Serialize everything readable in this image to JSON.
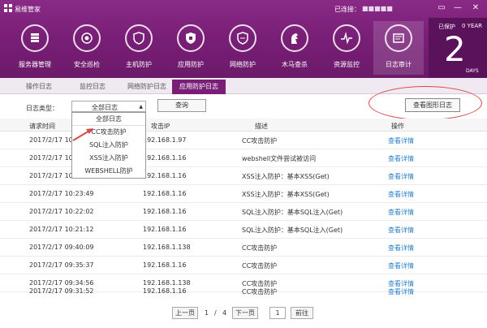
{
  "window": {
    "title": "易维管家",
    "connection_label": "已连接：",
    "connection_value": "■■■■■",
    "controls": [
      "▭",
      "—",
      "✕"
    ]
  },
  "nav": [
    {
      "label": "服务器管理",
      "icon": "server-cloud-icon"
    },
    {
      "label": "安全巡检",
      "icon": "target-icon"
    },
    {
      "label": "主机防护",
      "icon": "shield-icon"
    },
    {
      "label": "应用防护",
      "icon": "app-shield-icon"
    },
    {
      "label": "网络防护",
      "icon": "network-shield-icon"
    },
    {
      "label": "木马查杀",
      "icon": "horse-icon"
    },
    {
      "label": "资源监控",
      "icon": "pulse-icon"
    },
    {
      "label": "日志审计",
      "icon": "log-icon"
    }
  ],
  "protection": {
    "label": "已保护",
    "year": "0 YEAR",
    "days": "2",
    "days_label": "DAYS"
  },
  "tabs": [
    "操作日志",
    "监控日志",
    "网络防护日志",
    "应用防护日志"
  ],
  "filter": {
    "label": "日志类型：",
    "selected": "全部日志",
    "query_button": "查询",
    "graph_button": "查看图形日志"
  },
  "dropdown_options": [
    "全部日志",
    "CC攻击防护",
    "SQL注入防护",
    "XSS注入防护",
    "WEBSHELL防护"
  ],
  "table": {
    "headers": [
      "请求时间",
      "攻击IP",
      "描述",
      "操作"
    ],
    "rows": [
      {
        "time": "2017/2/17 10",
        "ip": "192.168.1.97",
        "desc": "CC攻击防护",
        "action": "查看详情"
      },
      {
        "time": "2017/2/17 10",
        "ip": "192.168.1.16",
        "desc": "webshell文件尝试被访问",
        "action": "查看详情"
      },
      {
        "time": "2017/2/17 10",
        "ip": "192.168.1.16",
        "desc": "XSS注入防护：基本XSS(Get)",
        "action": "查看详情"
      },
      {
        "time": "2017/2/17 10:23:49",
        "ip": "192.168.1.16",
        "desc": "XSS注入防护：基本XSS(Get)",
        "action": "查看详情"
      },
      {
        "time": "2017/2/17 10:22:02",
        "ip": "192.168.1.16",
        "desc": "SQL注入防护：基本SQL注入(Get)",
        "action": "查看详情"
      },
      {
        "time": "2017/2/17 10:21:12",
        "ip": "192.168.1.16",
        "desc": "SQL注入防护：基本SQL注入(Get)",
        "action": "查看详情"
      },
      {
        "time": "2017/2/17 09:40:09",
        "ip": "192.168.1.138",
        "desc": "CC攻击防护",
        "action": "查看详情"
      },
      {
        "time": "2017/2/17 09:35:37",
        "ip": "192.168.1.16",
        "desc": "CC攻击防护",
        "action": "查看详情"
      },
      {
        "time": "2017/2/17 09:34:56",
        "ip": "192.168.1.138",
        "desc": "CC攻击防护",
        "action": "查看详情"
      },
      {
        "time": "2017/2/17 09:31:52",
        "ip": "192.168.1.16",
        "desc": "CC攻击防护",
        "action": "查看详情"
      }
    ]
  },
  "pagination": {
    "prev": "上一页",
    "current": "1",
    "separator": "/",
    "total": "4",
    "next": "下一页",
    "goto_value": "1",
    "goto_button": "前往"
  },
  "colors": {
    "brand": "#7a1f78",
    "link": "#2a7fc7",
    "annotation": "#d94848"
  }
}
